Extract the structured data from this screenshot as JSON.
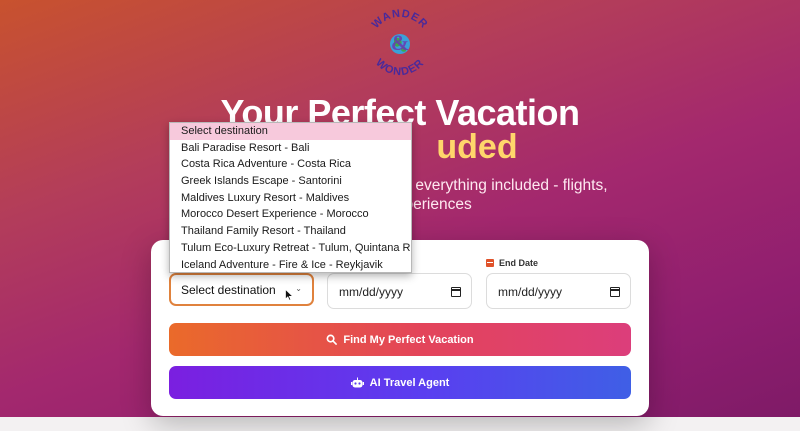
{
  "logo": {
    "line1": "WANDER",
    "symbol": "&",
    "line2": "WONDER"
  },
  "hero": {
    "title_line1": "Your Perfect Vacation",
    "title_line2_visible": "uded",
    "subtitle_line1_visible": "h everything included - flights,",
    "subtitle_line2_visible": "d experiences"
  },
  "form": {
    "destination": {
      "value": "Select destination"
    },
    "start_date": {
      "value": "mm/dd/yyyy"
    },
    "end_date": {
      "label": "End Date",
      "value": "mm/dd/yyyy"
    }
  },
  "dropdown": {
    "options": [
      "Select destination",
      "Bali Paradise Resort - Bali",
      "Costa Rica Adventure - Costa Rica",
      "Greek Islands Escape - Santorini",
      "Maldives Luxury Resort - Maldives",
      "Morocco Desert Experience - Morocco",
      "Thailand Family Resort - Thailand",
      "Tulum Eco-Luxury Retreat - Tulum, Quintana Roo",
      "Iceland Adventure - Fire & Ice - Reykjavik"
    ],
    "selected_index": 0
  },
  "buttons": {
    "find": "Find My Perfect Vacation",
    "ai": "AI Travel Agent"
  },
  "colors": {
    "accent_orange": "#e0823d",
    "find_gradient_start": "#ea6a2a",
    "find_gradient_end": "#dc3e7b",
    "ai_gradient_start": "#7b1fe0",
    "ai_gradient_end": "#3f5fe6",
    "title_highlight": "#ffd66b"
  },
  "icons": {
    "search": "search-icon",
    "robot": "robot-icon",
    "calendar": "calendar-icon"
  }
}
